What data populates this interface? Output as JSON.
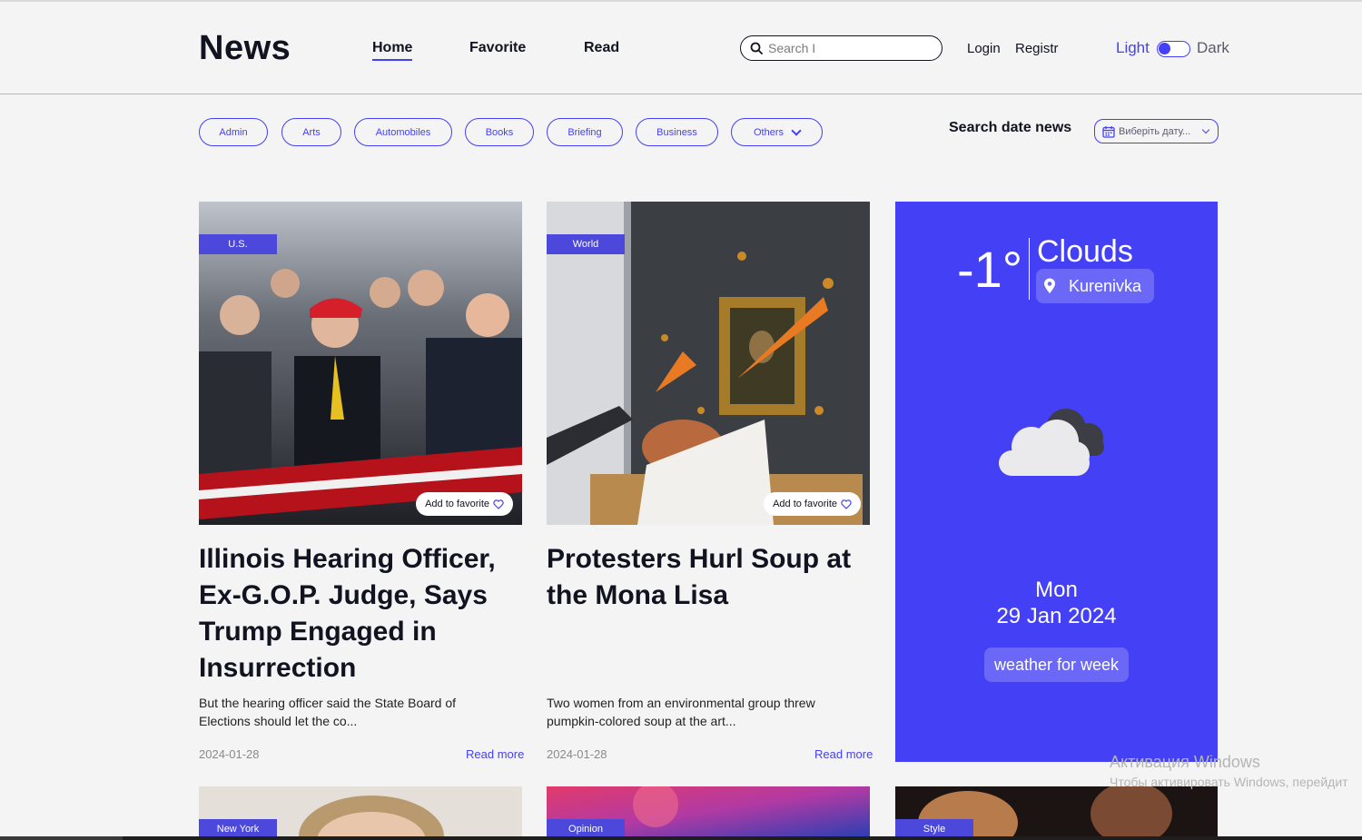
{
  "header": {
    "logo": "News",
    "nav": [
      "Home",
      "Favorite",
      "Read"
    ],
    "search_placeholder": "Search I",
    "login": "Login",
    "register": "Registr",
    "theme_light": "Light",
    "theme_dark": "Dark",
    "theme_toggle_state": "light"
  },
  "filters": {
    "categories": [
      "Admin",
      "Arts",
      "Automobiles",
      "Books",
      "Briefing",
      "Business"
    ],
    "others_label": "Others",
    "date_label": "Search date news",
    "date_placeholder": "Виберіть дату..."
  },
  "cards": [
    {
      "badge": "U.S.",
      "favorite": "Add to favorite",
      "title": "Illinois Hearing Officer, Ex-G.O.P. Judge, Says Trump Engaged in Insurrection",
      "description": "But the hearing officer said the State Board of Elections should let the co...",
      "date": "2024-01-28",
      "read_more": "Read more"
    },
    {
      "badge": "World",
      "favorite": "Add to favorite",
      "title": "Protesters Hurl Soup at the Mona Lisa",
      "description": "Two women from an environmental group threw pumpkin-colored soup at the art...",
      "date": "2024-01-28",
      "read_more": "Read more"
    }
  ],
  "weather": {
    "temperature": "-1°",
    "condition": "Clouds",
    "location": "Kurenivka",
    "day": "Mon",
    "date": "29 Jan 2024",
    "week_button": "weather for week",
    "icon": "clouds-icon"
  },
  "row2_badges": [
    "New York",
    "Opinion",
    "Style"
  ],
  "watermark": {
    "line1": "Активация Windows",
    "line2": "Чтобы активировать Windows, перейдит"
  },
  "colors": {
    "accent": "#4440F6",
    "badge": "#4B48DB",
    "background": "#F4F4F4",
    "text": "#111321"
  }
}
